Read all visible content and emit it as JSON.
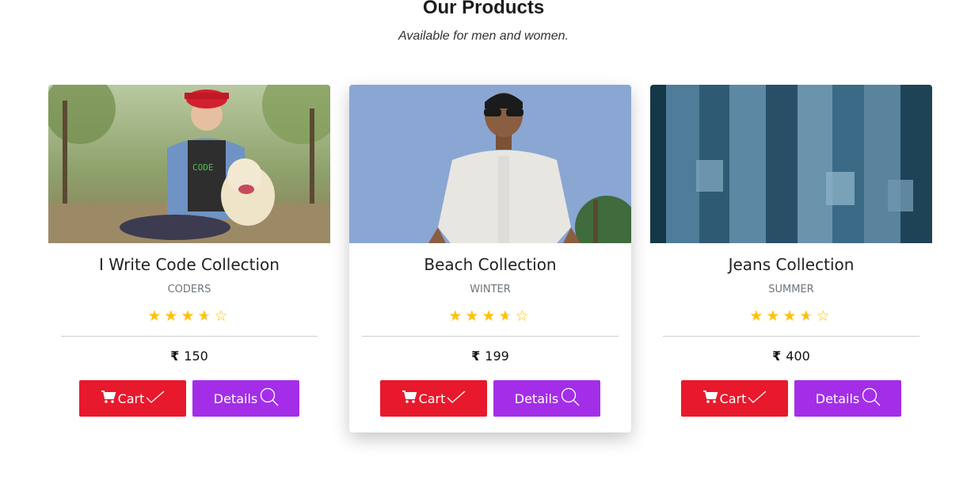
{
  "section": {
    "title": "Our Products",
    "subtitle": "Available for men and women."
  },
  "products": [
    {
      "title": "I Write Code Collection",
      "category": "CODERS",
      "rating": 3.5,
      "stars": [
        "★",
        "★",
        "★",
        "★",
        "☆"
      ],
      "currency_symbol": "₹",
      "price": "150",
      "cart_label": "Cart",
      "details_label": "Details",
      "image": "woman-with-dog-code-tshirt"
    },
    {
      "title": "Beach Collection",
      "category": "WINTER",
      "rating": 3.5,
      "stars": [
        "★",
        "★",
        "★",
        "★",
        "☆"
      ],
      "currency_symbol": "₹",
      "price": "199",
      "cart_label": "Cart",
      "details_label": "Details",
      "image": "man-in-sunglasses-blue-sky"
    },
    {
      "title": "Jeans Collection",
      "category": "SUMMER",
      "rating": 3.5,
      "stars": [
        "★",
        "★",
        "★",
        "★",
        "☆"
      ],
      "currency_symbol": "₹",
      "price": "400",
      "cart_label": "Cart",
      "details_label": "Details",
      "image": "hanging-denim-jeans"
    }
  ],
  "colors": {
    "cart_button": "#e8192c",
    "details_button": "#a42ee8",
    "star": "#ffc107"
  },
  "icons": {
    "cart": "shopping-cart-icon",
    "check": "checkmark-icon",
    "search": "magnifier-icon"
  }
}
